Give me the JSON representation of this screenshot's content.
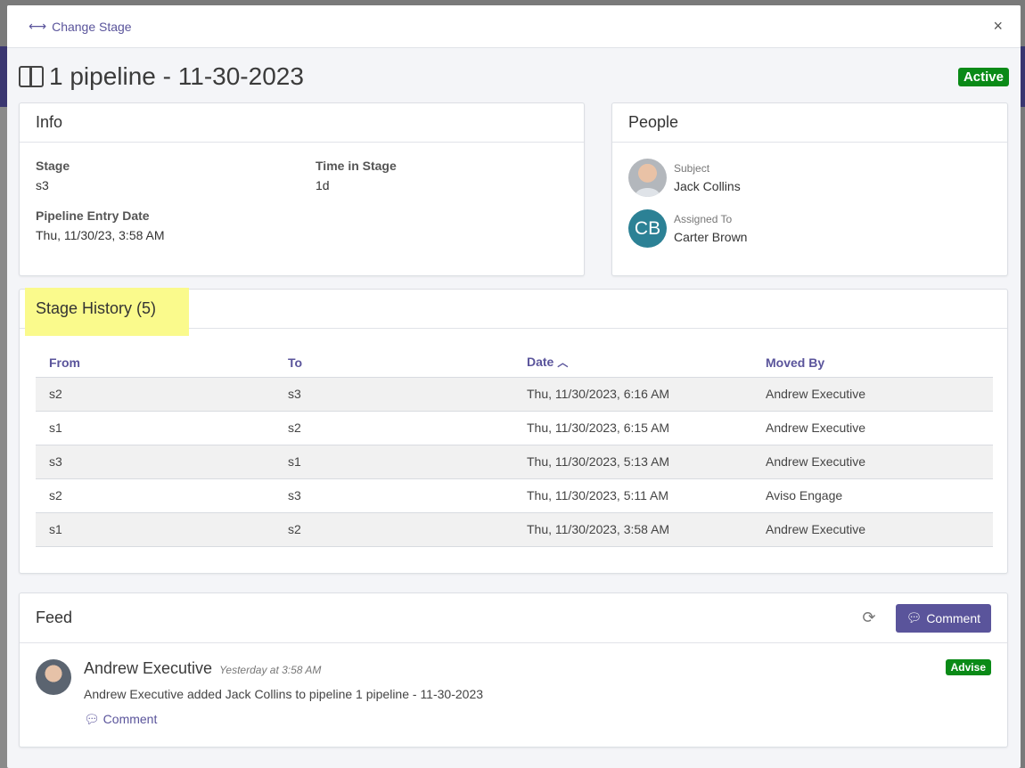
{
  "header": {
    "change_stage_label": "Change Stage",
    "close_label": "×"
  },
  "title": {
    "text": "1 pipeline - 11-30-2023",
    "status_badge": "Active"
  },
  "info": {
    "heading": "Info",
    "stage_label": "Stage",
    "stage_value": "s3",
    "time_label": "Time in Stage",
    "time_value": "1d",
    "entry_label": "Pipeline Entry Date",
    "entry_value": "Thu, 11/30/23, 3:58 AM"
  },
  "people": {
    "heading": "People",
    "subject_role": "Subject",
    "subject_name": "Jack Collins",
    "assigned_role": "Assigned To",
    "assigned_name": "Carter Brown",
    "assigned_initials": "CB"
  },
  "stage_history": {
    "heading": "Stage History (5)",
    "columns": [
      "From",
      "To",
      "Date",
      "Moved By"
    ],
    "rows": [
      [
        "s2",
        "s3",
        "Thu, 11/30/2023, 6:16 AM",
        "Andrew Executive"
      ],
      [
        "s1",
        "s2",
        "Thu, 11/30/2023, 6:15 AM",
        "Andrew Executive"
      ],
      [
        "s3",
        "s1",
        "Thu, 11/30/2023, 5:13 AM",
        "Andrew Executive"
      ],
      [
        "s2",
        "s3",
        "Thu, 11/30/2023, 5:11 AM",
        "Aviso Engage"
      ],
      [
        "s1",
        "s2",
        "Thu, 11/30/2023, 3:58 AM",
        "Andrew Executive"
      ]
    ]
  },
  "feed": {
    "heading": "Feed",
    "comment_button": "Comment",
    "item": {
      "author": "Andrew Executive",
      "time": "Yesterday at 3:58 AM",
      "text": "Andrew Executive added Jack Collins to pipeline 1 pipeline - 11-30-2023",
      "comment_link": "Comment",
      "badge": "Advise"
    }
  },
  "colors": {
    "accent": "#5a549b",
    "status_green": "#0a8a17",
    "highlight": "#fafa8c",
    "avatar_teal": "#2c8195"
  }
}
